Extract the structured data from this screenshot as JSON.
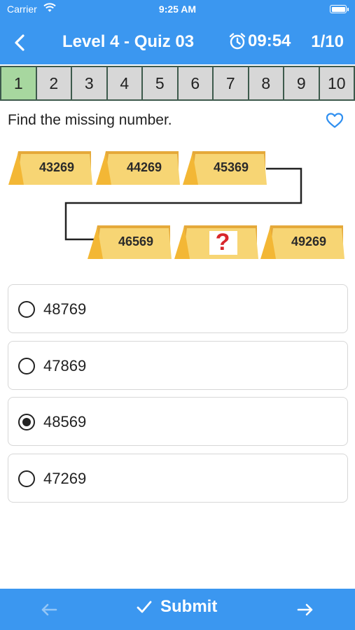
{
  "status_bar": {
    "carrier": "Carrier",
    "time": "9:25 AM"
  },
  "header": {
    "title": "Level 4 - Quiz 03",
    "timer": "09:54",
    "progress": "1/10",
    "color": "#3b97f0"
  },
  "question_nav": {
    "items": [
      "1",
      "2",
      "3",
      "4",
      "5",
      "6",
      "7",
      "8",
      "9",
      "10"
    ],
    "active_index": 0,
    "active_color": "#a7d79f",
    "inactive_color": "#d7d7d7"
  },
  "question": {
    "text": "Find the missing number.",
    "puzzle": {
      "row1": [
        "43269",
        "44269",
        "45369"
      ],
      "row2": [
        "46569",
        "?",
        "49269"
      ]
    }
  },
  "options": [
    {
      "label": "48769",
      "selected": false
    },
    {
      "label": "47869",
      "selected": false
    },
    {
      "label": "48569",
      "selected": true
    },
    {
      "label": "47269",
      "selected": false
    }
  ],
  "footer": {
    "submit_label": "Submit"
  }
}
